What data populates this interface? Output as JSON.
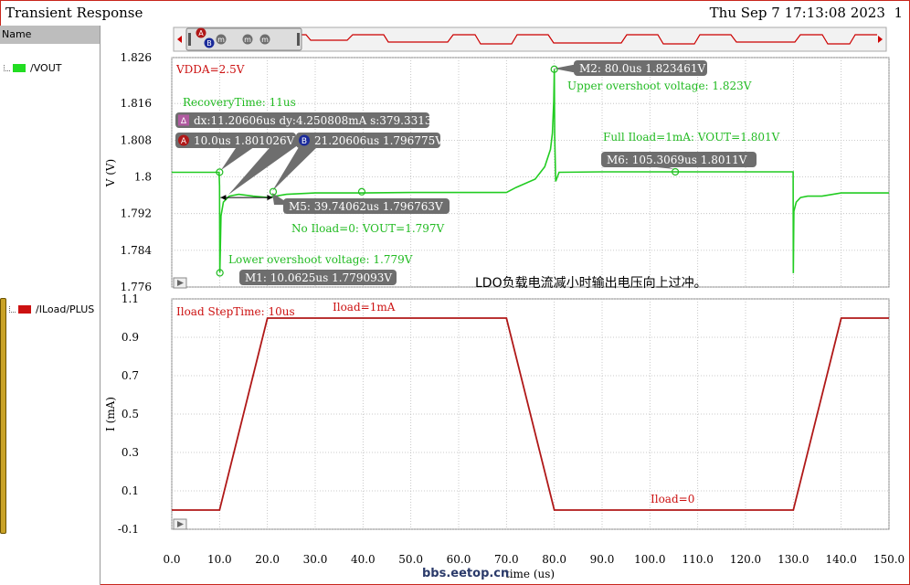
{
  "window": {
    "title": "Transient Response",
    "datestamp": "Thu Sep 7 17:13:08 2023",
    "page_number": "1"
  },
  "sidebar": {
    "header": "Name",
    "signals": [
      {
        "label": "/VOUT",
        "color": "#22dd22"
      },
      {
        "label": "/ILoad/PLUS",
        "color": "#cc1111"
      }
    ]
  },
  "overview_markers": [
    "A",
    "B",
    "m",
    "m",
    "m"
  ],
  "chinese_note": "LDO负载电流减小时输出电压向上过冲。",
  "watermark": "bbs.eetop.cn",
  "colors": {
    "vout": "#22cc22",
    "iload": "#b01818",
    "annot_bg": "#6e6e6e",
    "note_red": "#cc1111",
    "note_green": "#22bb22",
    "marker_A": "#b01818",
    "marker_B": "#1a2a9a",
    "delta": "#b05aa0"
  },
  "chart_data": [
    {
      "type": "line",
      "ylabel": "V (V)",
      "xlim": [
        0,
        150
      ],
      "ylim": [
        1.776,
        1.826
      ],
      "yticks": [
        "1.826",
        "1.816",
        "1.808",
        "1.8",
        "1.792",
        "1.784",
        "1.776"
      ],
      "ytick_values": [
        1.826,
        1.816,
        1.808,
        1.8,
        1.792,
        1.784,
        1.776
      ],
      "grid": true,
      "series": [
        {
          "name": "/VOUT",
          "x": [
            0,
            9.9,
            10.0,
            10.06,
            10.3,
            10.8,
            12,
            14,
            17,
            20,
            24,
            30,
            40,
            50,
            70,
            72,
            76,
            78,
            79.2,
            79.6,
            79.9,
            80.0,
            80.08,
            80.3,
            81,
            90,
            110,
            129.95,
            130.0,
            130.1,
            130.6,
            131.5,
            133,
            136,
            140,
            150
          ],
          "y": [
            1.801,
            1.801,
            1.798,
            1.7791,
            1.7915,
            1.7945,
            1.7958,
            1.7962,
            1.7958,
            1.7955,
            1.7962,
            1.7965,
            1.7965,
            1.7966,
            1.7966,
            1.7977,
            1.7995,
            1.8022,
            1.806,
            1.8095,
            1.8165,
            1.8235,
            1.809,
            1.799,
            1.801,
            1.8011,
            1.8011,
            1.8011,
            1.779,
            1.7925,
            1.7945,
            1.7955,
            1.7958,
            1.7958,
            1.7965,
            1.7965
          ]
        }
      ],
      "annotations": {
        "vdda": "VDDA=2.5V",
        "recovery": "RecoveryTime: 11us",
        "delta": "dx:11.20606us dy:4.250808mA s:379.3313",
        "markerA": "10.0us 1.801026V",
        "markerB": "21.20606us 1.796775V",
        "m5": "M5: 39.74062us 1.796763V",
        "no_iload": "No Iload=0: VOUT=1.797V",
        "lower_os": "Lower overshoot voltage: 1.779V",
        "m1": "M1: 10.0625us 1.779093V",
        "m2": "M2: 80.0us 1.823461V",
        "upper_os": "Upper overshoot voltage: 1.823V",
        "full_iload": "Full Iload=1mA: VOUT=1.801V",
        "m6": "M6: 105.3069us 1.8011V"
      }
    },
    {
      "type": "line",
      "xlabel": "time (us)",
      "ylabel": "I (mA)",
      "xlim": [
        0,
        150
      ],
      "ylim": [
        -0.1,
        1.1
      ],
      "yticks": [
        "1.1",
        "0.9",
        "0.7",
        "0.5",
        "0.3",
        "0.1",
        "-0.1"
      ],
      "ytick_values": [
        1.1,
        0.9,
        0.7,
        0.5,
        0.3,
        0.1,
        -0.1
      ],
      "xticks": [
        "0.0",
        "10.0",
        "20.0",
        "30.0",
        "40.0",
        "50.0",
        "60.0",
        "70.0",
        "80.0",
        "90.0",
        "100.0",
        "110.0",
        "120.0",
        "130.0",
        "140.0",
        "150.0"
      ],
      "xtick_values": [
        0,
        10,
        20,
        30,
        40,
        50,
        60,
        70,
        80,
        90,
        100,
        110,
        120,
        130,
        140,
        150
      ],
      "grid": true,
      "series": [
        {
          "name": "/ILoad/PLUS",
          "x": [
            0,
            10,
            20,
            70,
            80,
            130,
            140,
            150
          ],
          "y": [
            0,
            0,
            1,
            1,
            0,
            0,
            1,
            1
          ]
        }
      ],
      "annotations": {
        "steptime": "Iload StepTime: 10us",
        "iload1": "Iload=1mA",
        "iload0": "Iload=0"
      }
    }
  ]
}
